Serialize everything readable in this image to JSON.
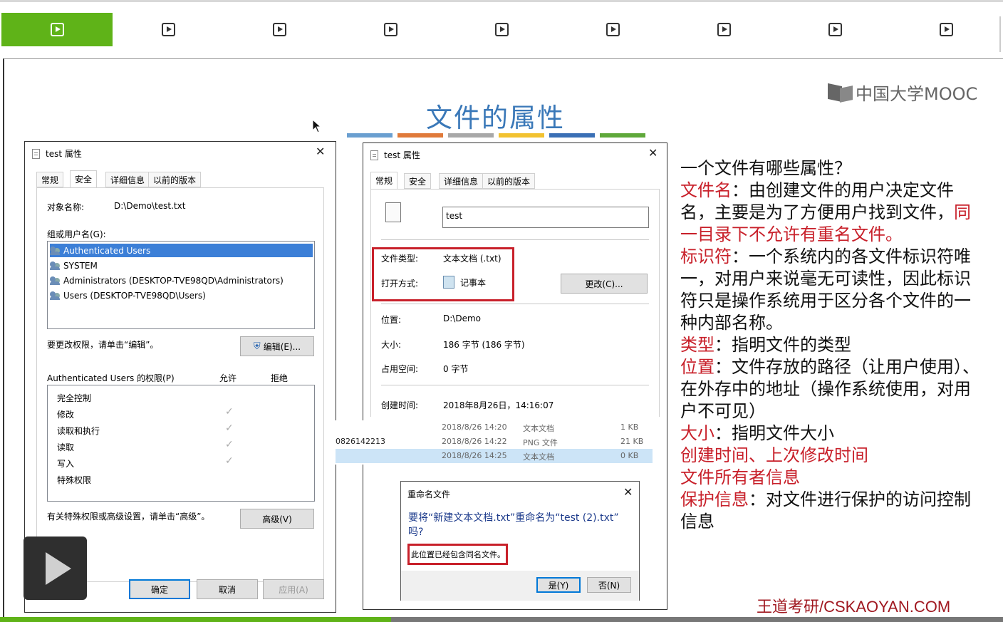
{
  "player": {
    "segments": 9,
    "active_segment": 1,
    "progress_fraction": 0.39
  },
  "slide": {
    "title": "文件的属性",
    "logo_text": "中国大学MOOC",
    "credit": "王道考研/CSKAOYAN.COM",
    "stripe_colors": [
      "#6a9fd0",
      "#e07a3a",
      "#a8a8a8",
      "#f2c230",
      "#3a6fb5",
      "#5fa83a"
    ]
  },
  "security_dialog": {
    "title": "test 属性",
    "tabs": [
      "常规",
      "安全",
      "详细信息",
      "以前的版本"
    ],
    "selected_tab": "安全",
    "object_label": "对象名称:",
    "object_value": "D:\\Demo\\test.txt",
    "group_label": "组或用户名(G):",
    "users": [
      "Authenticated Users",
      "SYSTEM",
      "Administrators (DESKTOP-TVE98QD\\Administrators)",
      "Users (DESKTOP-TVE98QD\\Users)"
    ],
    "change_hint": "要更改权限，请单击“编辑”。",
    "edit_button": "编辑(E)...",
    "perm_header": "Authenticated Users 的权限(P)",
    "allow_header": "允许",
    "deny_header": "拒绝",
    "permissions": [
      "完全控制",
      "修改",
      "读取和执行",
      "读取",
      "写入",
      "特殊权限"
    ],
    "allowed": [
      false,
      true,
      true,
      true,
      true,
      false
    ],
    "advanced_hint": "有关特殊权限或高级设置，请单击“高级”。",
    "advanced_button": "高级(V)",
    "ok_button": "确定",
    "cancel_button": "取消",
    "apply_button": "应用(A)"
  },
  "general_dialog": {
    "title": "test 属性",
    "tabs": [
      "常规",
      "安全",
      "详细信息",
      "以前的版本"
    ],
    "selected_tab": "常规",
    "name_value": "test",
    "type_label": "文件类型:",
    "type_value": "文本文档 (.txt)",
    "open_label": "打开方式:",
    "open_value": "记事本",
    "change_button": "更改(C)...",
    "location_label": "位置:",
    "location_value": "D:\\Demo",
    "size_label": "大小:",
    "size_value": "186 字节 (186 字节)",
    "disk_label": "占用空间:",
    "disk_value": "0 字节",
    "created_label": "创建时间:",
    "created_value": "2018年8月26日，14:16:07"
  },
  "explorer_rows": [
    {
      "name": "",
      "date": "2018/8/26 14:20",
      "type": "文本文档",
      "size": "1 KB"
    },
    {
      "name": "0826142213",
      "date": "2018/8/26 14:22",
      "type": "PNG 文件",
      "size": "21 KB"
    },
    {
      "name": "",
      "date": "2018/8/26 14:25",
      "type": "文本文档",
      "size": "0 KB"
    }
  ],
  "rename_dialog": {
    "title": "重命名文件",
    "message": "要将“新建文本文档.txt”重命名为“test (2).txt”吗?",
    "message_line1": "要将“新建文本文档.txt”重命名为“test (2).txt”",
    "message_line2": "吗?",
    "warning": "此位置已经包含同名文件。",
    "yes_button": "是(Y)",
    "no_button": "否(N)"
  },
  "notes": {
    "question": "一个文件有哪些属性？",
    "items": [
      {
        "key": "文件名",
        "text": "：由创建文件的用户决定文件名，主要是为了方便用户找到文件，",
        "emph": "同一目录下不允许有重名文件。"
      },
      {
        "key": "标识符",
        "text": "：一个系统内的各文件标识符唯一，对用户来说毫无可读性，因此标识符只是操作系统用于区分各个文件的一种内部名称。"
      },
      {
        "key": "类型",
        "text": "：指明文件的类型"
      },
      {
        "key": "位置",
        "text": "：文件存放的路径（让用户使用）、在外存中的地址（操作系统使用，对用户不可见）"
      },
      {
        "key": "大小",
        "text": "：指明文件大小"
      },
      {
        "key": "创建时间、上次修改时间",
        "text": ""
      },
      {
        "key": "文件所有者信息",
        "text": ""
      },
      {
        "key": "保护信息",
        "text": "：对文件进行保护的访问控制信息"
      }
    ]
  }
}
